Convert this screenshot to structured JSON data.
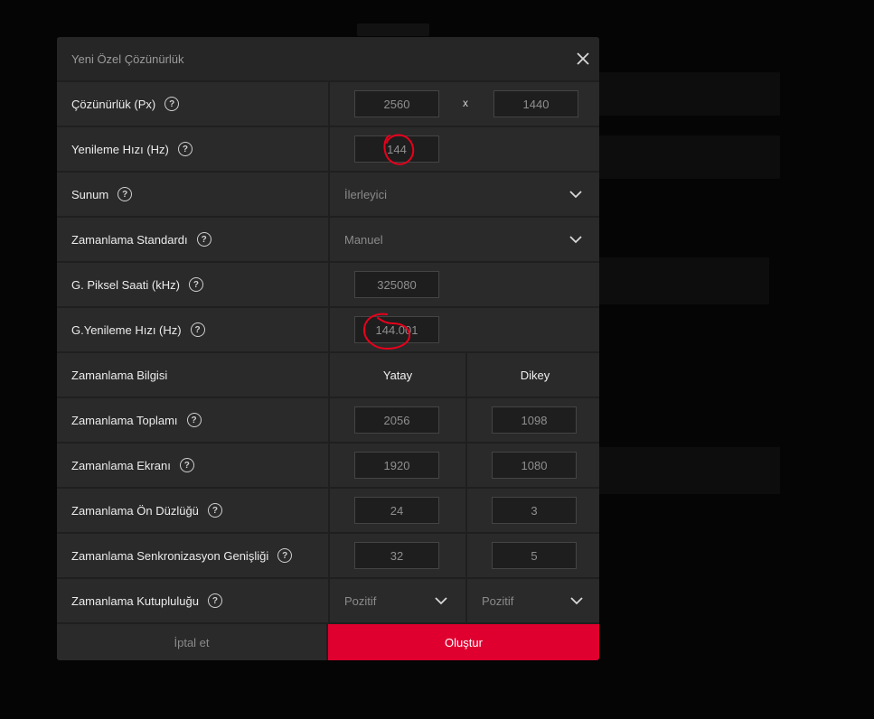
{
  "dialog": {
    "title": "Yeni Özel Çözünürlük",
    "close_icon": "close-icon"
  },
  "rows": {
    "resolution": {
      "label": "Çözünürlük (Px)",
      "width": "2560",
      "separator": "x",
      "height": "1440"
    },
    "refresh_rate": {
      "label": "Yenileme Hızı (Hz)",
      "value": "144"
    },
    "scan": {
      "label": "Sunum",
      "value": "İlerleyici"
    },
    "timing_standard": {
      "label": "Zamanlama Standardı",
      "value": "Manuel"
    },
    "pixel_clock": {
      "label": "G. Piksel Saati (kHz)",
      "value": "325080"
    },
    "effective_refresh": {
      "label": "G.Yenileme Hızı (Hz)",
      "value": "144.001"
    },
    "timing_info": {
      "label": "Zamanlama Bilgisi",
      "horizontal": "Yatay",
      "vertical": "Dikey"
    },
    "timing_total": {
      "label": "Zamanlama Toplamı",
      "h": "2056",
      "v": "1098"
    },
    "timing_display": {
      "label": "Zamanlama Ekranı",
      "h": "1920",
      "v": "1080"
    },
    "front_porch": {
      "label": "Zamanlama Ön Düzlüğü",
      "h": "24",
      "v": "3"
    },
    "sync_width": {
      "label": "Zamanlama Senkronizasyon Genişliği",
      "h": "32",
      "v": "5"
    },
    "polarity": {
      "label": "Zamanlama Kutupluluğu",
      "h": "Pozitif",
      "v": "Pozitif"
    }
  },
  "footer": {
    "cancel_label": "İptal et",
    "create_label": "Oluştur"
  },
  "help_glyph": "?",
  "colors": {
    "accent": "#e0002f",
    "annotation": "#e8001c",
    "panel": "#2a2a2a"
  }
}
